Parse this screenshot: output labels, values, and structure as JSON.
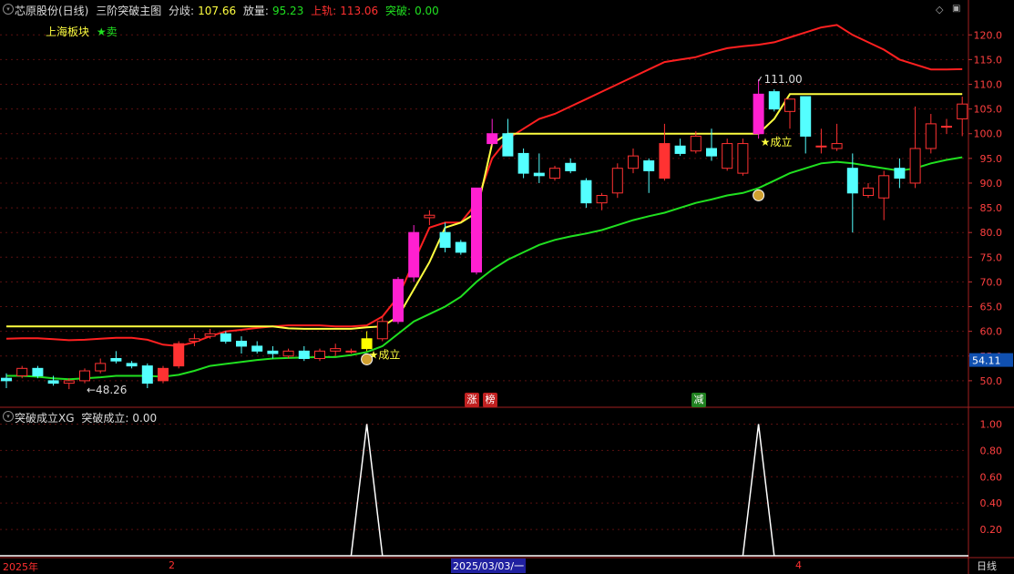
{
  "header": {
    "stock": "芯原股份(日线)",
    "indicator": "三阶突破主图",
    "fenqi_label": "分歧:",
    "fenqi_value": "107.66",
    "fangliang_label": "放量:",
    "fangliang_value": "95.23",
    "shangzhui_label": "上轨:",
    "shangzhui_value": "113.06",
    "tupo_label": "突破:",
    "tupo_value": "0.00"
  },
  "legend": {
    "block": "上海板块",
    "sell": "★卖"
  },
  "sub_header": {
    "name": "突破成立XG",
    "label": "突破成立:",
    "value": "0.00"
  },
  "bottom_bar": {
    "start": "2025年",
    "month2": "2",
    "cursor_date": "2025/03/03/一",
    "month4": "4",
    "period": "日线"
  },
  "badges": {
    "zhang": "涨",
    "bang": "榜",
    "jian": "减"
  },
  "colors": {
    "up": "#ff3232",
    "down": "#54ffff",
    "upper": "#ff2020",
    "mid": "#ffff40",
    "lower": "#20e020",
    "magenta": "#ff20d0",
    "yellowbar": "#ffff00"
  },
  "chart_data": {
    "type": "candlestick",
    "y_ticks_main": [
      50,
      55,
      60,
      65,
      70,
      75,
      80,
      85,
      90,
      95,
      100,
      105,
      110,
      115,
      120
    ],
    "ylim_main": [
      45,
      123
    ],
    "y_ticks_sub": [
      0.2,
      0.4,
      0.6,
      0.8,
      1.0
    ],
    "ylim_sub": [
      0,
      1.1
    ],
    "current_price": "54.11",
    "annotations": {
      "high": "111.00",
      "low": "48.26",
      "established": "★成立"
    },
    "candles": [
      [
        50.5,
        51.5,
        48.5,
        50.0
      ],
      [
        51.0,
        53.0,
        50.5,
        52.5
      ],
      [
        52.5,
        53.0,
        50.5,
        51.0
      ],
      [
        50.0,
        51.0,
        49.0,
        49.5
      ],
      [
        49.5,
        50.5,
        48.3,
        50.0
      ],
      [
        50.0,
        52.5,
        49.5,
        52.0
      ],
      [
        52.0,
        54.5,
        51.5,
        53.5
      ],
      [
        54.5,
        56.0,
        53.5,
        54.0
      ],
      [
        53.5,
        54.0,
        52.5,
        53.0
      ],
      [
        53.0,
        53.5,
        48.5,
        49.5
      ],
      [
        50.0,
        53.0,
        49.5,
        52.5
      ],
      [
        53.0,
        58.0,
        52.5,
        57.5
      ],
      [
        58.0,
        59.5,
        57.0,
        58.5
      ],
      [
        59.0,
        60.5,
        58.5,
        59.5
      ],
      [
        59.5,
        60.0,
        57.5,
        58.0
      ],
      [
        58.0,
        59.0,
        55.5,
        57.0
      ],
      [
        57.0,
        58.0,
        55.5,
        56.0
      ],
      [
        56.0,
        57.0,
        54.5,
        55.5
      ],
      [
        55.0,
        56.5,
        54.5,
        56.0
      ],
      [
        56.0,
        57.0,
        54.0,
        54.5
      ],
      [
        54.5,
        56.5,
        54.0,
        56.0
      ],
      [
        56.0,
        57.5,
        55.0,
        56.5
      ],
      [
        56.0,
        56.5,
        55.5,
        56.0
      ],
      [
        56.5,
        60.0,
        56.0,
        58.5
      ],
      [
        58.5,
        63.0,
        58.0,
        62.0
      ],
      [
        62.0,
        71.0,
        61.5,
        70.5
      ],
      [
        71.0,
        81.5,
        70.0,
        80.0
      ],
      [
        83.0,
        84.5,
        81.5,
        83.5
      ],
      [
        80.0,
        82.0,
        76.0,
        77.0
      ],
      [
        78.0,
        78.5,
        75.5,
        76.0
      ],
      [
        72.0,
        89.0,
        71.5,
        89.0
      ],
      [
        98.0,
        103.0,
        97.5,
        100.0
      ],
      [
        100.0,
        103.0,
        98.0,
        95.5
      ],
      [
        96.0,
        97.0,
        91.0,
        92.0
      ],
      [
        92.0,
        96.0,
        90.0,
        91.5
      ],
      [
        91.0,
        93.5,
        90.5,
        93.0
      ],
      [
        94.0,
        95.0,
        92.0,
        92.5
      ],
      [
        90.5,
        91.0,
        85.0,
        86.0
      ],
      [
        86.0,
        88.0,
        84.5,
        87.5
      ],
      [
        88.0,
        94.0,
        87.0,
        93.0
      ],
      [
        93.0,
        97.0,
        92.0,
        95.5
      ],
      [
        94.5,
        95.0,
        88.0,
        92.5
      ],
      [
        91.0,
        102.0,
        90.5,
        98.0
      ],
      [
        97.5,
        99.0,
        95.5,
        96.0
      ],
      [
        96.5,
        100.5,
        96.0,
        99.5
      ],
      [
        97.0,
        101.0,
        94.5,
        95.5
      ],
      [
        93.0,
        99.0,
        92.5,
        98.0
      ],
      [
        92.0,
        99.0,
        91.5,
        98.0
      ],
      [
        100.0,
        111.0,
        99.0,
        108.0
      ],
      [
        108.5,
        109.0,
        104.5,
        105.0
      ],
      [
        104.5,
        107.0,
        101.0,
        107.0
      ],
      [
        107.5,
        107.5,
        96.0,
        99.5
      ],
      [
        97.5,
        101.0,
        96.0,
        97.5
      ],
      [
        97.0,
        102.0,
        96.5,
        98.0
      ],
      [
        93.0,
        96.0,
        80.0,
        88.0
      ],
      [
        87.5,
        90.0,
        87.0,
        89.0
      ],
      [
        87.0,
        92.5,
        82.5,
        91.5
      ],
      [
        93.0,
        95.0,
        89.0,
        91.0
      ],
      [
        90.0,
        105.5,
        89.0,
        97.0
      ],
      [
        97.0,
        104.0,
        96.0,
        102.0
      ],
      [
        101.5,
        103.0,
        100.0,
        101.5
      ],
      [
        103.0,
        107.5,
        99.5,
        106.0
      ]
    ],
    "upper_band": [
      58.5,
      58.6,
      58.6,
      58.4,
      58.2,
      58.3,
      58.5,
      58.7,
      58.7,
      58.3,
      57.3,
      57.0,
      57.8,
      59.0,
      60.0,
      60.3,
      60.7,
      61.0,
      61.2,
      61.2,
      61.2,
      61.0,
      61.0,
      61.2,
      63.0,
      67.0,
      74.0,
      81.0,
      82.0,
      82.0,
      86.0,
      95.0,
      99.0,
      101.0,
      103.0,
      104.0,
      105.5,
      107.0,
      108.5,
      110.0,
      111.5,
      113.0,
      114.5,
      115.0,
      115.5,
      116.5,
      117.3,
      117.7,
      118.0,
      118.5,
      119.5,
      120.5,
      121.5,
      122.0,
      120.0,
      118.5,
      117.0,
      115.0,
      114.0,
      113.0,
      113.0,
      113.06
    ],
    "mid_line": [
      61.0,
      61.0,
      61.0,
      61.0,
      61.0,
      61.0,
      61.0,
      61.0,
      61.0,
      61.0,
      61.0,
      61.0,
      61.0,
      61.0,
      61.0,
      61.0,
      61.0,
      61.0,
      60.6,
      60.5,
      60.5,
      60.5,
      60.5,
      60.8,
      61.0,
      63.0,
      68.5,
      74.0,
      81.0,
      82.0,
      84.0,
      98.0,
      100.0,
      100.0,
      100.0,
      100.0,
      100.0,
      100.0,
      100.0,
      100.0,
      100.0,
      100.0,
      100.0,
      100.0,
      100.0,
      100.0,
      100.0,
      100.0,
      100.0,
      103.0,
      108.0,
      108.0,
      108.0,
      108.0,
      108.0,
      108.0,
      108.0,
      108.0,
      108.0,
      108.0,
      108.0,
      108.0
    ],
    "lower_band": [
      51.0,
      51.0,
      50.8,
      50.5,
      50.3,
      50.5,
      50.7,
      51.0,
      51.0,
      51.0,
      50.8,
      51.2,
      52.0,
      53.0,
      53.4,
      53.8,
      54.2,
      54.5,
      54.6,
      54.7,
      54.8,
      54.8,
      55.2,
      55.8,
      57.0,
      59.5,
      62.0,
      63.5,
      65.0,
      67.0,
      70.0,
      72.5,
      74.5,
      76.0,
      77.5,
      78.5,
      79.2,
      79.8,
      80.5,
      81.5,
      82.5,
      83.3,
      84.0,
      85.0,
      86.0,
      86.7,
      87.5,
      88.0,
      89.0,
      90.5,
      92.0,
      93.0,
      94.0,
      94.3,
      94.0,
      93.5,
      93.0,
      92.5,
      93.0,
      94.0,
      94.7,
      95.23
    ],
    "breakout_signal": [
      0,
      0,
      0,
      0,
      0,
      0,
      0,
      0,
      0,
      0,
      0,
      0,
      0,
      0,
      0,
      0,
      0,
      0,
      0,
      0,
      0,
      0,
      0,
      1,
      0,
      0,
      0,
      0,
      0,
      0,
      0,
      0,
      0,
      0,
      0,
      0,
      0,
      0,
      0,
      0,
      0,
      0,
      0,
      0,
      0,
      0,
      0,
      0,
      1,
      0,
      0,
      0,
      0,
      0,
      0,
      0,
      0,
      0,
      0,
      0,
      0,
      0
    ]
  }
}
